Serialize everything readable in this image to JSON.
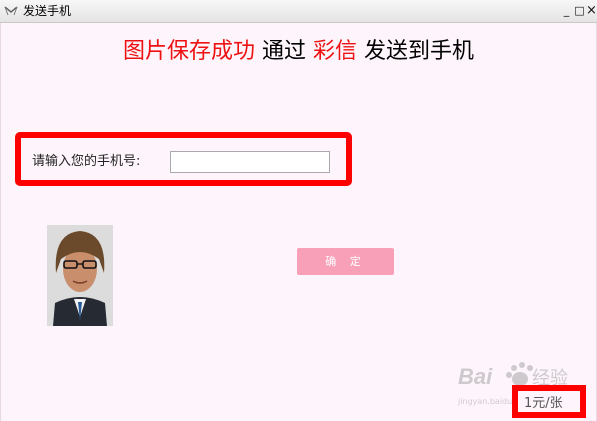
{
  "window": {
    "title": "发送手机",
    "app_icon": "envelope-icon",
    "minimize": "_",
    "maximize": "□",
    "close": "×"
  },
  "headline": {
    "part1": "图片保存成功",
    "part2": "通过",
    "part3": "彩信",
    "part4": "发送到手机"
  },
  "form": {
    "phone_label": "请输入您的手机号:",
    "phone_value": "",
    "phone_placeholder": "",
    "confirm_label": "确 定"
  },
  "price": "1元/张",
  "watermark": {
    "brand": "Baidu",
    "sub": "jingyan.baidu.com",
    "text": "经验"
  },
  "colors": {
    "highlight_red": "#ff0000",
    "headline_red": "#ee1111",
    "confirm_button": "#f9a0b9",
    "background": "#fdf5fb"
  }
}
